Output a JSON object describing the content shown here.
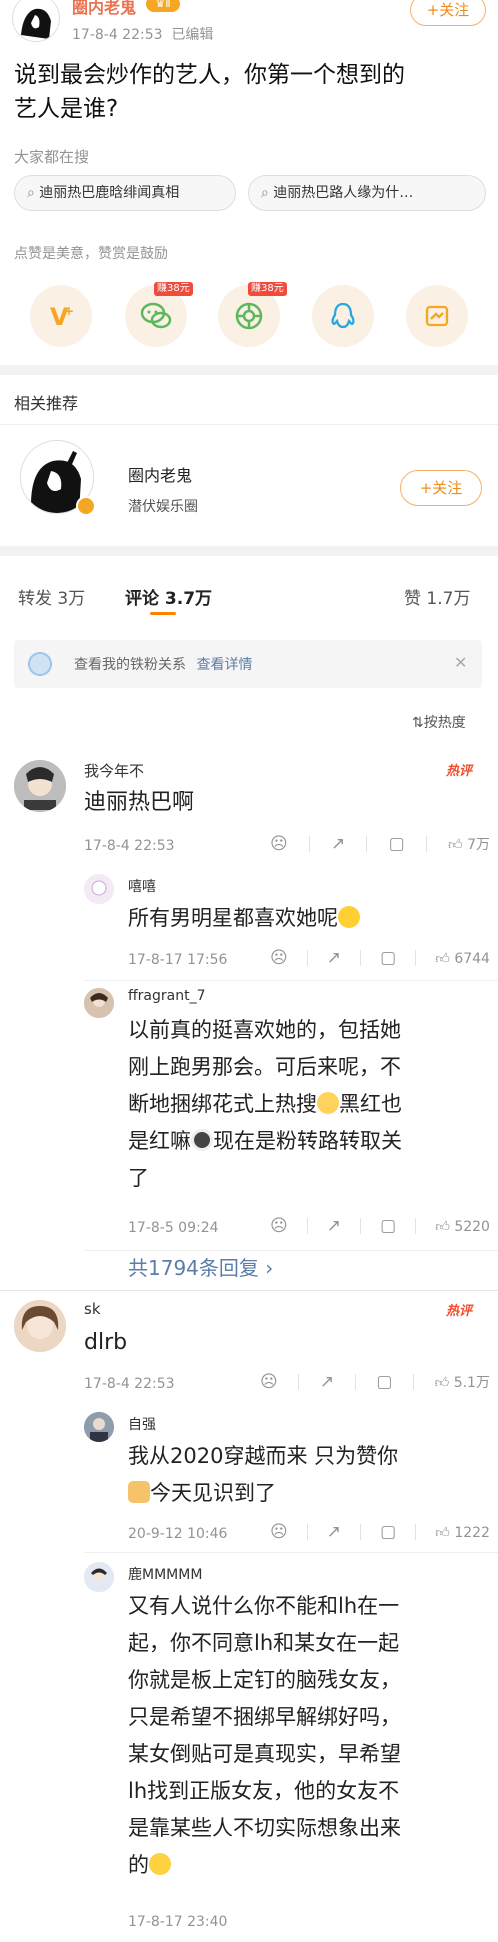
{
  "post": {
    "author": "圈内老鬼",
    "level": "Ⅱ",
    "meta": "17-8-4 22:53",
    "edited": "已编辑",
    "follow_label": "+关注",
    "text_line1": "说到最会炒作的艺人，你第一个想到的",
    "text_line2": "艺人是谁?"
  },
  "search": {
    "label": "大家都在搜",
    "chips": [
      "迪丽热巴鹿晗绯闻真相",
      "迪丽热巴路人缘为什…"
    ]
  },
  "reward": {
    "label": "点赞是美意，赞赏是鼓励",
    "items": [
      {
        "icon": "weibo-v-icon",
        "badge": ""
      },
      {
        "icon": "wechat-icon",
        "badge": "赚38元"
      },
      {
        "icon": "moments-icon",
        "badge": "赚38元"
      },
      {
        "icon": "qq-icon",
        "badge": ""
      },
      {
        "icon": "qzone-icon",
        "badge": ""
      }
    ]
  },
  "related": {
    "label": "相关推荐",
    "name": "圈内老鬼",
    "desc": "潜伏娱乐圈",
    "follow_label": "+关注"
  },
  "tabs": {
    "repost": "转发 3万",
    "comments": "评论 3.7万",
    "likes": "赞 1.7万"
  },
  "fans_banner": {
    "text": "查看我的铁粉关系",
    "link": "查看详情",
    "close": "✕"
  },
  "sort_label": "按热度",
  "comments": [
    {
      "user": "我今年不",
      "hot": "热评",
      "text": "迪丽热巴啊",
      "time": "17-8-4 22:53",
      "likes": "7万",
      "replies": [
        {
          "user": "嘻嘻",
          "text_lines": [
            "所有男明星都喜欢她呢"
          ],
          "time": "17-8-17 17:56",
          "likes": "6744"
        },
        {
          "user": "ffragrant_7",
          "text_lines": [
            "以前真的挺喜欢她的，包括她",
            "刚上跑男那会。可后来呢，不",
            "断地捆绑花式上热搜",
            "黑红也",
            "是红嘛",
            "现在是粉转路转取关",
            "了"
          ],
          "time": "17-8-5 09:24",
          "likes": "5220"
        }
      ],
      "more_replies": "共1794条回复 ›"
    },
    {
      "user": "sk",
      "hot": "热评",
      "text": "dlrb",
      "time": "17-8-4 22:53",
      "likes": "5.1万",
      "replies": [
        {
          "user": "自强",
          "text_lines": [
            "我从2020穿越而来 只为赞你",
            "今天见识到了"
          ],
          "time": "20-9-12 10:46",
          "likes": "1222"
        },
        {
          "user": "鹿MMMMM",
          "text_lines": [
            "又有人说什么你不能和lh在一",
            "起，你不同意lh和某女在一起",
            "你就是板上定钉的脑残女友，",
            "只是希望不捆绑早解绑好吗，",
            "某女倒贴可是真现实，早希望",
            "lh找到正版女友，他的女友不",
            "是靠某些人不切实际想象出来",
            "的"
          ],
          "time": "17-8-17 23:40",
          "likes": ""
        }
      ]
    }
  ],
  "colors": {
    "accent": "#ff8200",
    "hot": "#f24d2c",
    "link": "#eb7350",
    "reply_more": "#5b7da8"
  }
}
